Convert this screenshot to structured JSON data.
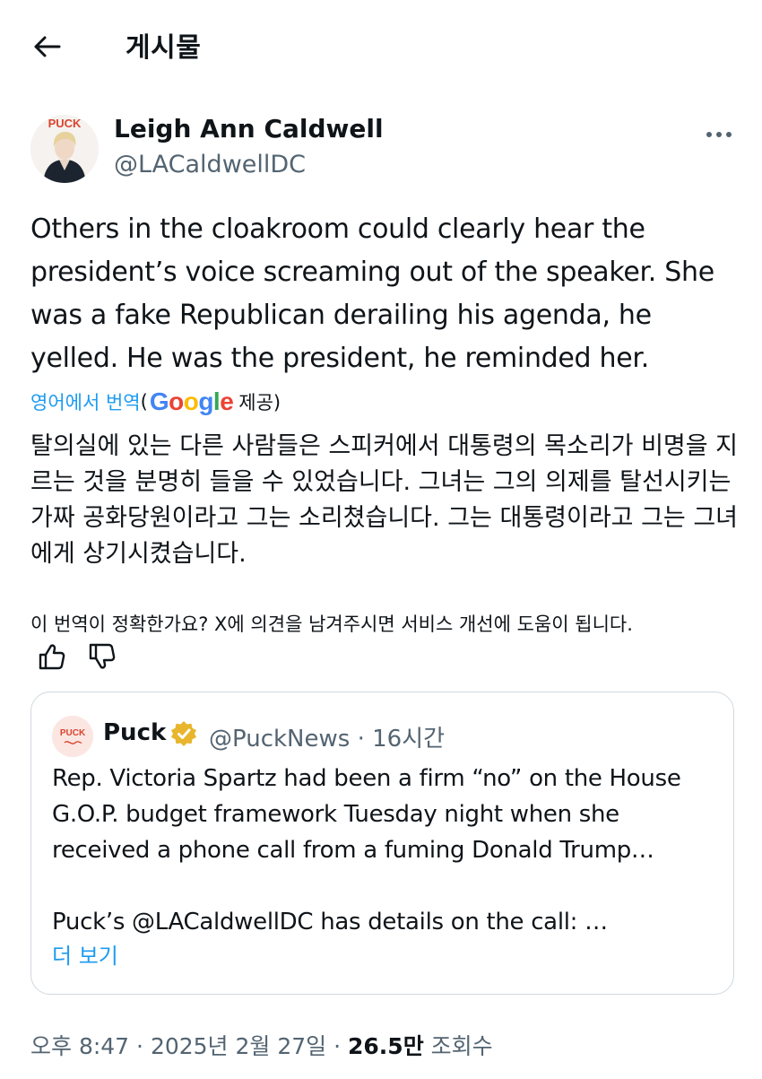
{
  "header": {
    "title": "게시물",
    "back_icon": "arrow-left-icon"
  },
  "author": {
    "name": "Leigh Ann Caldwell",
    "handle": "@LACaldwellDC",
    "more_icon": "more-horizontal-icon"
  },
  "tweet": {
    "text": "Others in the cloakroom could clearly hear the president’s voice screaming out of the speaker. She was a fake Republican derailing his agenda, he yelled. He was the president, he reminded her.",
    "translate_link": "영어에서 번역",
    "translate_open_paren": "(",
    "google_logo": "Google",
    "translate_provider_suffix": " 제공)",
    "translated_text": "탈의실에 있는 다른 사람들은 스피커에서 대통령의 목소리가 비명을 지르는 것을 분명히 들을 수 있었습니다. 그녀는 그의 의제를 탈선시키는 가짜 공화당원이라고 그는 소리쳤습니다. 그는 대통령이라고 그는 그녀에게 상기시켰습니다.",
    "feedback_prompt": "이 번역이 정확한가요? X에 의견을 남겨주시면 서비스 개선에 도움이 됩니다."
  },
  "quote": {
    "name": "Puck",
    "handle": "@PuckNews",
    "separator": " · ",
    "time": "16시간",
    "text_lines": [
      "Rep. Victoria Spartz had been a firm “no” on the House",
      "G.O.P. budget framework Tuesday night when she",
      "received a phone call from a fuming Donald Trump…",
      "",
      "Puck’s @LACaldwellDC has details on the call: …"
    ],
    "show_more": "더 보기",
    "avatar_logo_text": "PUCK"
  },
  "meta": {
    "time": "오후 8:47",
    "sep1": " · ",
    "date": "2025년 2월 27일",
    "sep2": " · ",
    "views_count": "26.5만",
    "views_label": " 조회수"
  },
  "colors": {
    "text": "#0f1419",
    "secondary": "#536471",
    "link": "#1d9bf0",
    "border": "#cfd9de",
    "verified": "#e8b52c"
  }
}
